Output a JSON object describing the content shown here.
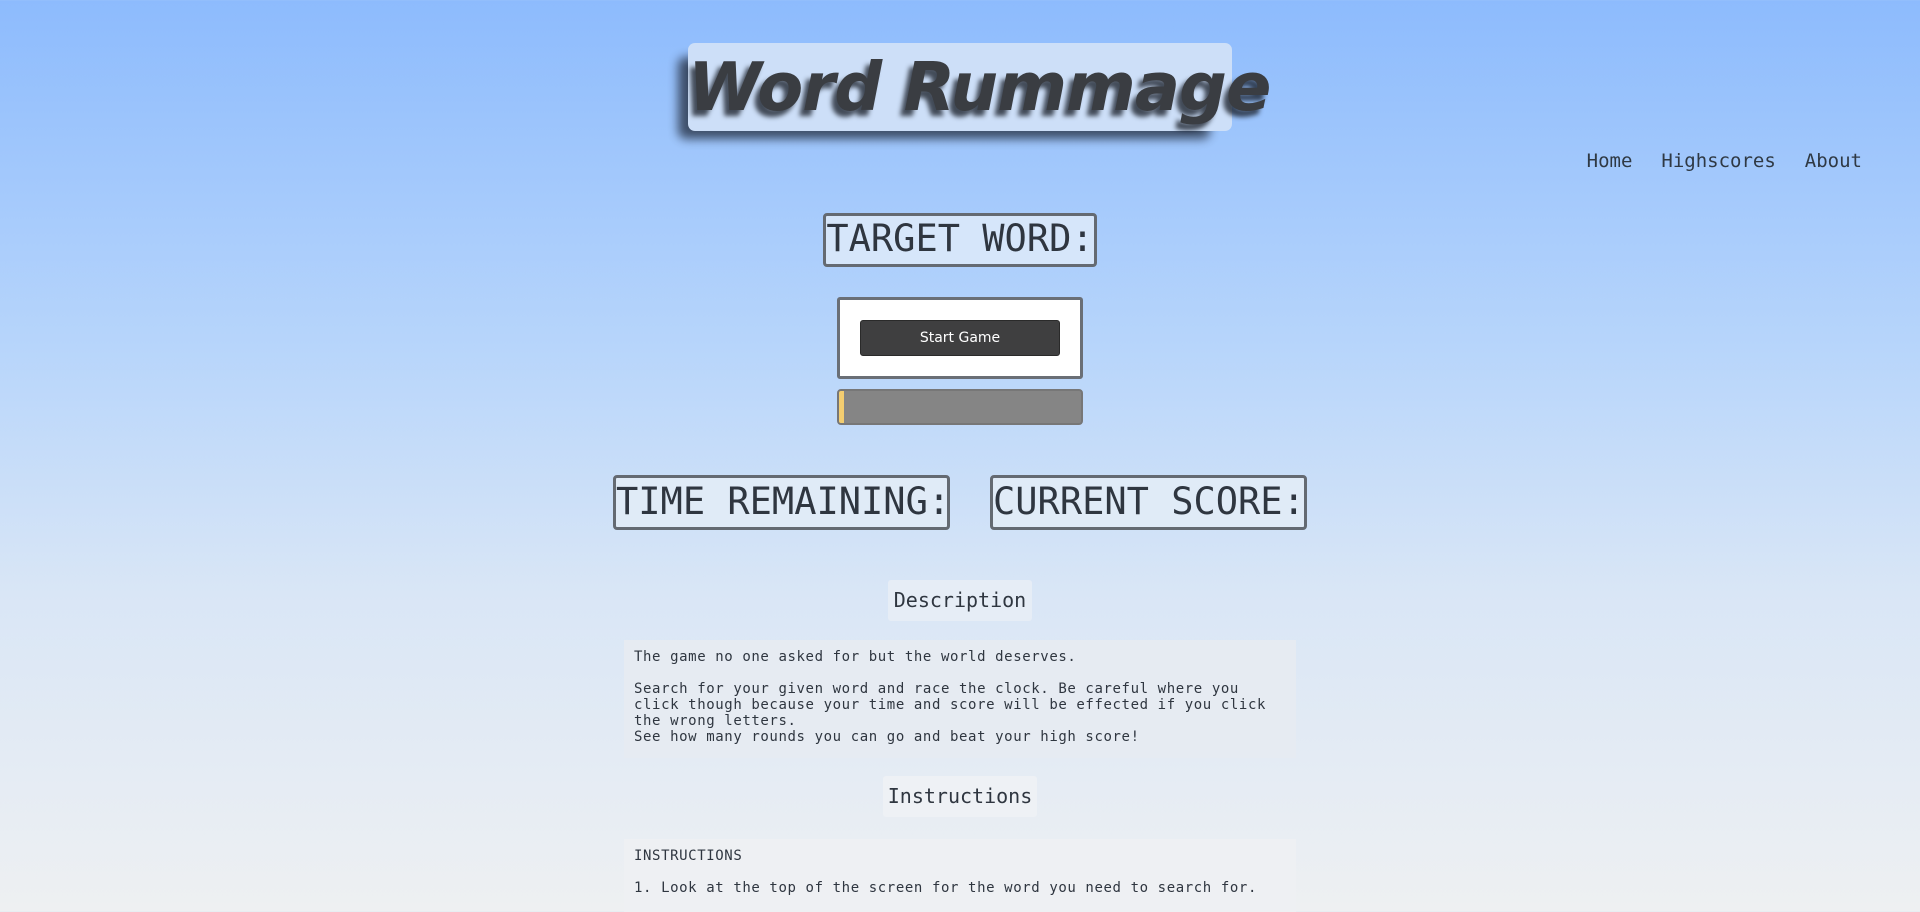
{
  "header": {
    "title": "Word Rummage"
  },
  "nav": {
    "items": [
      "Home",
      "Highscores",
      "About"
    ]
  },
  "game": {
    "target_word_label": "TARGET WORD:",
    "start_button_label": "Start Game",
    "progress_fraction": 0.02,
    "progress_color": "#f3cd70",
    "time_remaining_label": "TIME REMAINING:",
    "current_score_label": "CURRENT SCORE:"
  },
  "description": {
    "heading": "Description",
    "line1": "The game no one asked for but the world deserves.",
    "line2": "Search for your given word and race the clock. Be careful where you click though because your time and score will be effected if you click the wrong letters.",
    "line3": "See how many rounds you can go and beat your high score!"
  },
  "instructions": {
    "heading": "Instructions",
    "title": "INSTRUCTIONS",
    "step1": "1. Look at the top of the screen for the word you need to search for."
  },
  "colors": {
    "background_top": "#8dbbfd",
    "background_bottom": "#eef0f2",
    "start_button": "#3f3f40",
    "progress_track": "#858585"
  }
}
